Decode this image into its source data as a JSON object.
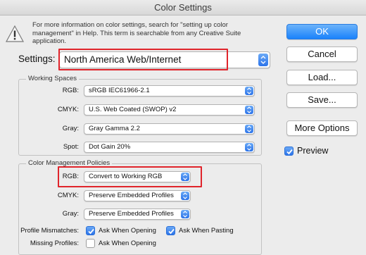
{
  "window": {
    "title": "Color Settings"
  },
  "info": {
    "text": "For more information on color settings, search for \"setting up color management\" in Help. This term is searchable from any Creative Suite application."
  },
  "settings": {
    "label": "Settings:",
    "value": "North America Web/Internet"
  },
  "working_spaces": {
    "title": "Working Spaces",
    "rows": [
      {
        "label": "RGB:",
        "value": "sRGB IEC61966-2.1"
      },
      {
        "label": "CMYK:",
        "value": "U.S. Web Coated (SWOP) v2"
      },
      {
        "label": "Gray:",
        "value": "Gray Gamma 2.2"
      },
      {
        "label": "Spot:",
        "value": "Dot Gain 20%"
      }
    ]
  },
  "policies": {
    "title": "Color Management Policies",
    "rows": [
      {
        "label": "RGB:",
        "value": "Convert to Working RGB"
      },
      {
        "label": "CMYK:",
        "value": "Preserve Embedded Profiles"
      },
      {
        "label": "Gray:",
        "value": "Preserve Embedded Profiles"
      }
    ],
    "profile_mismatches_label": "Profile Mismatches:",
    "missing_profiles_label": "Missing Profiles:",
    "ask_when_opening_1": "Ask When Opening",
    "ask_when_pasting": "Ask When Pasting",
    "ask_when_opening_2": "Ask When Opening",
    "checked": {
      "mismatch_opening": true,
      "mismatch_pasting": true,
      "missing_opening": false
    }
  },
  "buttons": {
    "ok": "OK",
    "cancel": "Cancel",
    "load": "Load...",
    "save": "Save...",
    "more_options": "More Options"
  },
  "preview": {
    "label": "Preview",
    "checked": true
  },
  "colors": {
    "highlight": "#e0242b",
    "accent": "#2c74ea"
  }
}
